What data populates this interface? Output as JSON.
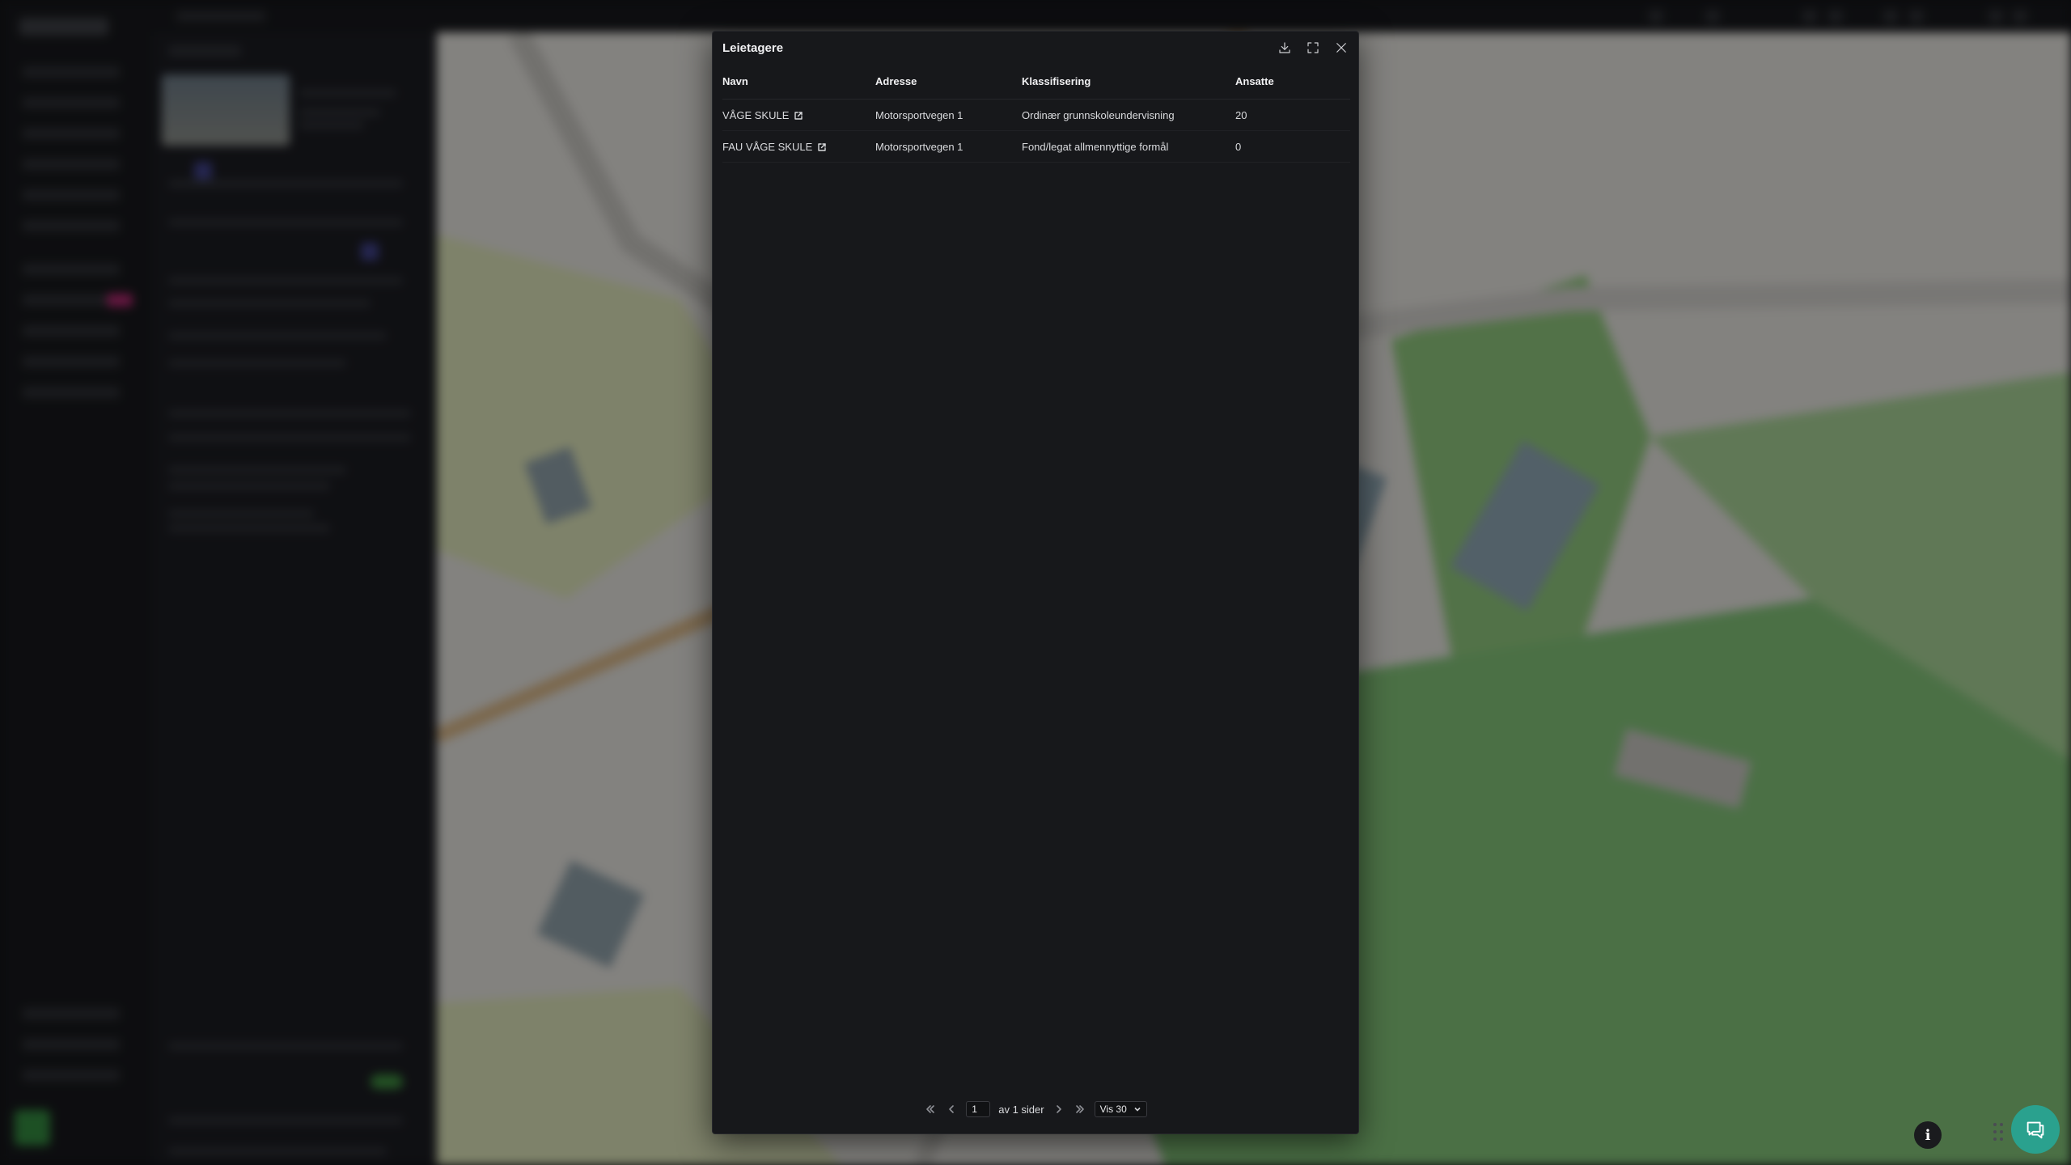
{
  "dialog": {
    "title": "Leietagere",
    "columns": [
      "Navn",
      "Adresse",
      "Klassifisering",
      "Ansatte"
    ],
    "rows": [
      {
        "name": "VÅGE SKULE",
        "address": "Motorsportvegen 1",
        "classification": "Ordinær grunnskoleundervisning",
        "employees": "20"
      },
      {
        "name": "FAU VÅGE SKULE",
        "address": "Motorsportvegen 1",
        "classification": "Fond/legat allmennyttige formål",
        "employees": "0"
      }
    ],
    "header_icons": [
      "download-icon",
      "fullscreen-icon",
      "close-icon"
    ]
  },
  "pagination": {
    "current_page": "1",
    "total_text": "av 1 sider",
    "page_size": "Vis 30"
  },
  "floating": {
    "info_icon": "i",
    "chat_icon": "chat-icon"
  },
  "colors": {
    "dialog_bg": "#17181b",
    "chat_button": "#2aa18e",
    "map_green": "#7fbf6f"
  }
}
